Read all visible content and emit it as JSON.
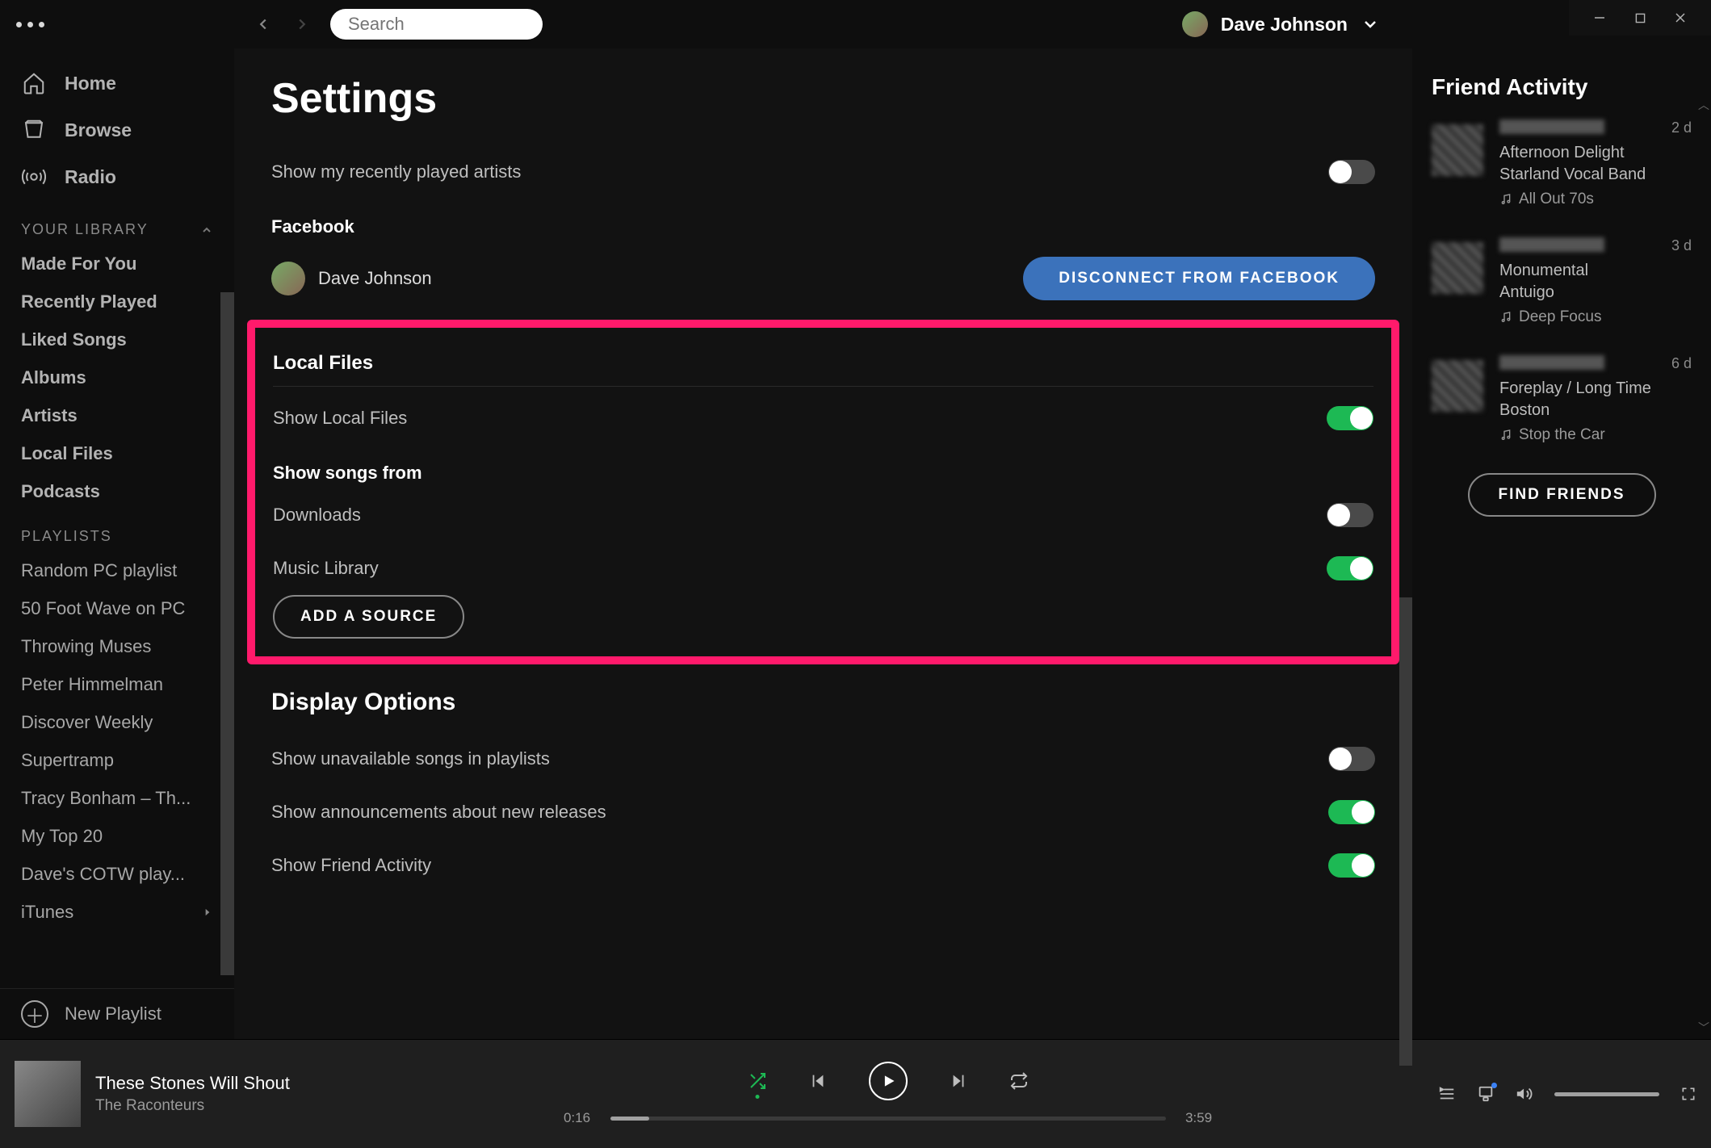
{
  "window": {
    "user_name": "Dave Johnson"
  },
  "search": {
    "placeholder": "Search"
  },
  "sidebar": {
    "main": [
      {
        "label": "Home",
        "icon": "home-icon"
      },
      {
        "label": "Browse",
        "icon": "browse-icon"
      },
      {
        "label": "Radio",
        "icon": "radio-icon"
      }
    ],
    "library_header": "YOUR LIBRARY",
    "library": [
      "Made For You",
      "Recently Played",
      "Liked Songs",
      "Albums",
      "Artists",
      "Local Files",
      "Podcasts"
    ],
    "playlists_header": "PLAYLISTS",
    "playlists": [
      "Random PC playlist",
      "50 Foot Wave on PC",
      "Throwing Muses",
      "Peter Himmelman",
      "Discover Weekly",
      "Supertramp",
      "Tracy Bonham – Th...",
      "My Top 20",
      "Dave's COTW play...",
      "iTunes"
    ],
    "new_playlist": "New Playlist"
  },
  "settings": {
    "title": "Settings",
    "show_recent": "Show my recently played artists",
    "facebook": {
      "header": "Facebook",
      "user": "Dave Johnson",
      "disconnect": "DISCONNECT FROM FACEBOOK"
    },
    "local_files": {
      "header": "Local Files",
      "show_local": "Show Local Files",
      "show_from": "Show songs from",
      "downloads": "Downloads",
      "music_library": "Music Library",
      "add_source": "ADD A SOURCE"
    },
    "display": {
      "header": "Display Options",
      "unavailable": "Show unavailable songs in playlists",
      "announcements": "Show announcements about new releases",
      "friend_activity": "Show Friend Activity"
    }
  },
  "friend": {
    "header": "Friend Activity",
    "items": [
      {
        "time": "2 d",
        "track": "Afternoon Delight",
        "artist": "Starland Vocal Band",
        "playlist": "All Out 70s"
      },
      {
        "time": "3 d",
        "track": "Monumental",
        "artist": "Antuigo",
        "playlist": "Deep Focus"
      },
      {
        "time": "6 d",
        "track": "Foreplay / Long Time",
        "artist": "Boston",
        "playlist": "Stop the Car"
      }
    ],
    "find": "FIND FRIENDS"
  },
  "player": {
    "track": "These Stones Will Shout",
    "artist": "The Raconteurs",
    "elapsed": "0:16",
    "total": "3:59",
    "progress_pct": 7
  }
}
